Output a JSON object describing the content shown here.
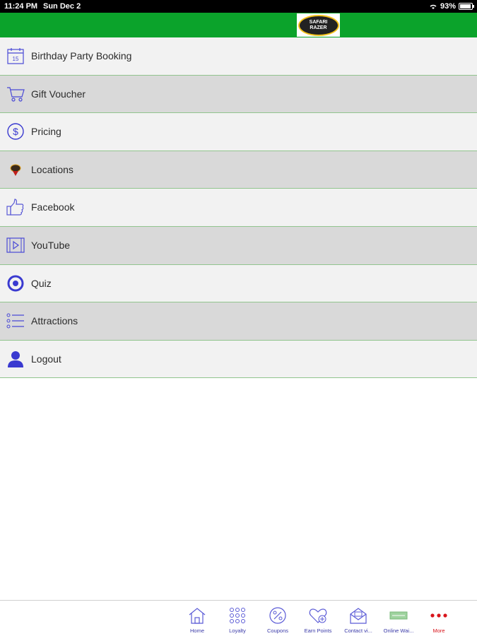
{
  "status_bar": {
    "time": "11:24 PM",
    "date": "Sun Dec 2",
    "battery": "93%",
    "battery_level": 0.93
  },
  "header": {
    "logo_line1": "SAFARI",
    "logo_line2": "RAZER"
  },
  "menu": {
    "items": [
      {
        "label": "Birthday Party Booking",
        "icon": "calendar-icon"
      },
      {
        "label": "Gift Voucher",
        "icon": "cart-icon"
      },
      {
        "label": "Pricing",
        "icon": "dollar-icon"
      },
      {
        "label": "Locations",
        "icon": "location-pin-icon"
      },
      {
        "label": "Facebook",
        "icon": "thumbs-up-icon"
      },
      {
        "label": "YouTube",
        "icon": "video-icon"
      },
      {
        "label": "Quiz",
        "icon": "target-icon"
      },
      {
        "label": "Attractions",
        "icon": "list-icon"
      },
      {
        "label": "Logout",
        "icon": "user-icon"
      }
    ]
  },
  "tabbar": {
    "tabs": [
      {
        "label": "Home",
        "icon": "home-icon"
      },
      {
        "label": "Loyalty",
        "icon": "grid-icon"
      },
      {
        "label": "Coupons",
        "icon": "percent-icon"
      },
      {
        "label": "Earn Points",
        "icon": "heart-plus-icon"
      },
      {
        "label": "Contact vi...",
        "icon": "envelope-icon"
      },
      {
        "label": "Online Wai...",
        "icon": "ticket-icon"
      },
      {
        "label": "More",
        "icon": "more-dots-icon"
      }
    ]
  },
  "colors": {
    "accent": "#0ba32b",
    "icon_blue": "#3a3ad0",
    "active_red": "#d8141b"
  }
}
